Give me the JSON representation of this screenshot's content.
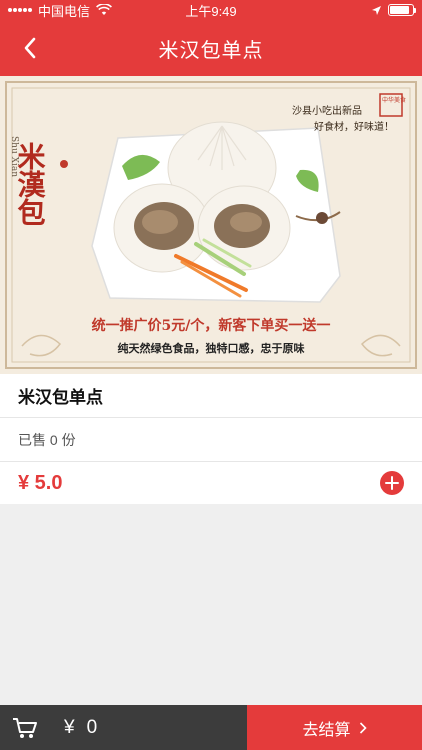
{
  "status_bar": {
    "carrier": "中国电信",
    "time": "上午9:49"
  },
  "nav": {
    "title": "米汉包单点"
  },
  "hero": {
    "logo_text": "米漢包",
    "logo_pinyin": "Shu Xian",
    "tagline_line1": "沙县小吃出新品",
    "tagline_line2": "好食材，好味道！",
    "stamp": "中华美食",
    "promo_line": "统一推广价5元/个，新客下单买一送一",
    "sub_line": "纯天然绿色食品，独特口感，忠于原味"
  },
  "product": {
    "name": "米汉包单点",
    "sold": "已售 0 份",
    "price": "¥ 5.0"
  },
  "cart": {
    "currency": "¥",
    "total": "0",
    "checkout_label": "去结算"
  },
  "colors": {
    "accent": "#e43b3b",
    "bottom_bar": "#3c3c3c"
  }
}
